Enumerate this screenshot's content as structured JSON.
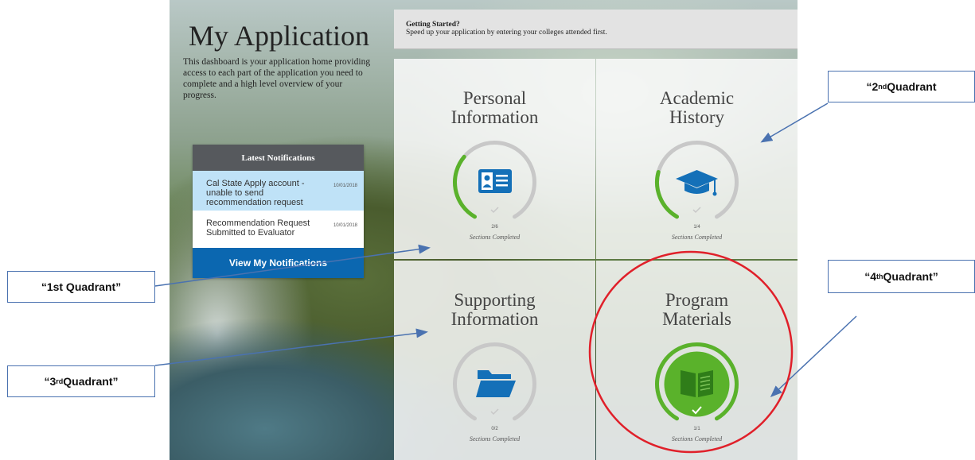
{
  "page": {
    "title": "My Application",
    "description": "This dashboard is your application home providing access to each part of the application you need to complete and a high level overview of your progress."
  },
  "notifications": {
    "header": "Latest Notifications",
    "items": [
      {
        "text": "Cal State Apply account - unable to send recommendation request",
        "date": "10/01/2018"
      },
      {
        "text": "Recommendation Request Submitted to Evaluator",
        "date": "10/01/2018"
      }
    ],
    "button": "View My Notifications"
  },
  "banner": {
    "heading": "Getting Started?",
    "text": "Speed up your application by entering your colleges attended first."
  },
  "quadrants": [
    {
      "title_line1": "Personal",
      "title_line2": "Information",
      "icon": "id-card-icon",
      "count": "2/6",
      "progress": 0.3333,
      "label": "Sections Completed"
    },
    {
      "title_line1": "Academic",
      "title_line2": "History",
      "icon": "graduation-cap-icon",
      "count": "1/4",
      "progress": 0.25,
      "label": "Sections Completed"
    },
    {
      "title_line1": "Supporting",
      "title_line2": "Information",
      "icon": "folder-icon",
      "count": "0/2",
      "progress": 0,
      "label": "Sections Completed"
    },
    {
      "title_line1": "Program",
      "title_line2": "Materials",
      "icon": "book-icon",
      "count": "1/1",
      "progress": 1,
      "label": "Sections Completed"
    }
  ],
  "callouts": {
    "q1": "“1st Quadrant”",
    "q2_prefix": "“2",
    "q2_sup": "nd",
    "q2_suffix": " Quadrant",
    "q3_prefix": "“3",
    "q3_sup": "rd",
    "q3_suffix": " Quadrant”",
    "q4_prefix": "“4",
    "q4_sup": "th",
    "q4_suffix": " Quadrant”"
  },
  "colors": {
    "progress_green": "#5ab22b",
    "ring_gray": "#c8c8c8",
    "icon_blue": "#1470b8",
    "notification_button": "#0b67b0",
    "callout_border": "#4a72b0",
    "highlight_circle": "#e0202a"
  }
}
